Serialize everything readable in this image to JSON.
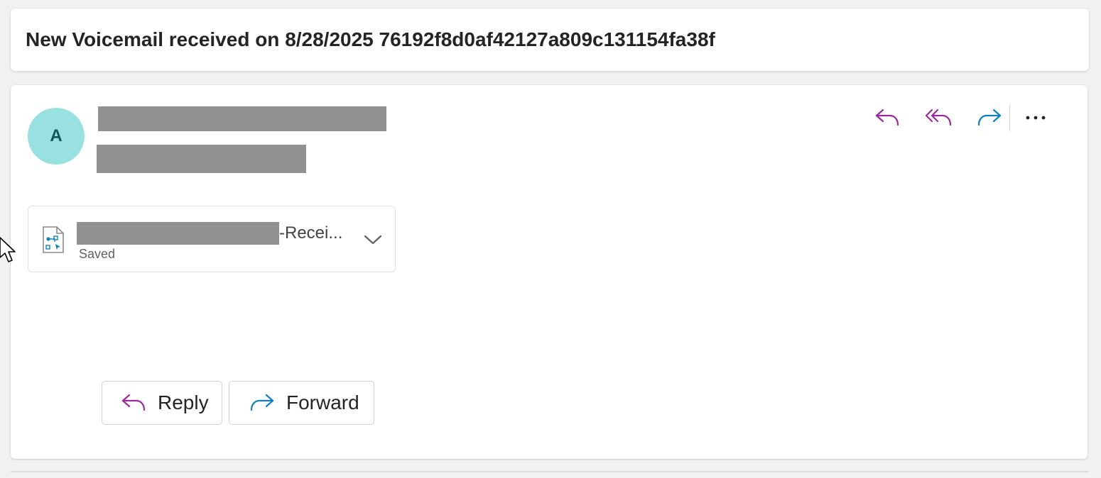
{
  "subject": {
    "text": "New Voicemail received on 8/28/2025 76192f8d0af42127a809c131154fa38f"
  },
  "message": {
    "avatar_initial": "A",
    "actions": {
      "reply_icon": "reply-icon",
      "reply_all_icon": "reply-all-icon",
      "forward_icon": "forward-icon",
      "more_icon": "more-icon"
    },
    "attachment": {
      "name_suffix": "-Recei...",
      "status": "Saved",
      "icon": "voice-file-icon"
    },
    "footer": {
      "reply_label": "Reply",
      "forward_label": "Forward"
    }
  },
  "colors": {
    "reply_accent": "#9b2a9e",
    "forward_accent": "#0f7fc3",
    "avatar_bg": "#99e1e0",
    "avatar_fg": "#0d5957"
  }
}
